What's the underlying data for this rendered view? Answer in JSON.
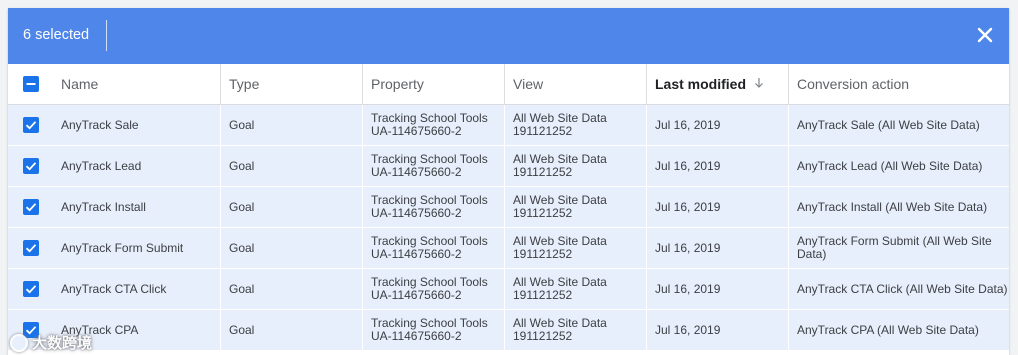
{
  "selection_bar": {
    "count_label": "6 selected",
    "close_icon": "close-icon",
    "color": "#4e86ea"
  },
  "table": {
    "columns": [
      {
        "label": "Name"
      },
      {
        "label": "Type"
      },
      {
        "label": "Property"
      },
      {
        "label": "View"
      },
      {
        "label": "Last modified",
        "sorted": true,
        "sort_icon": "arrow-down-icon"
      },
      {
        "label": "Conversion action"
      }
    ],
    "rows": [
      {
        "name": "AnyTrack Sale",
        "type": "Goal",
        "property_name": "Tracking School Tools",
        "property_id": "UA-114675660-2",
        "view_name": "All Web Site Data",
        "view_id": "191121252",
        "last_modified": "Jul 16, 2019",
        "conversion_action": "AnyTrack Sale (All Web Site Data)",
        "checked": true
      },
      {
        "name": "AnyTrack Lead",
        "type": "Goal",
        "property_name": "Tracking School Tools",
        "property_id": "UA-114675660-2",
        "view_name": "All Web Site Data",
        "view_id": "191121252",
        "last_modified": "Jul 16, 2019",
        "conversion_action": "AnyTrack Lead (All Web Site Data)",
        "checked": true
      },
      {
        "name": "AnyTrack Install",
        "type": "Goal",
        "property_name": "Tracking School Tools",
        "property_id": "UA-114675660-2",
        "view_name": "All Web Site Data",
        "view_id": "191121252",
        "last_modified": "Jul 16, 2019",
        "conversion_action": "AnyTrack Install (All Web Site Data)",
        "checked": true
      },
      {
        "name": "AnyTrack Form Submit",
        "type": "Goal",
        "property_name": "Tracking School Tools",
        "property_id": "UA-114675660-2",
        "view_name": "All Web Site Data",
        "view_id": "191121252",
        "last_modified": "Jul 16, 2019",
        "conversion_action": "AnyTrack Form Submit (All Web Site Data)",
        "checked": true
      },
      {
        "name": "AnyTrack CTA Click",
        "type": "Goal",
        "property_name": "Tracking School Tools",
        "property_id": "UA-114675660-2",
        "view_name": "All Web Site Data",
        "view_id": "191121252",
        "last_modified": "Jul 16, 2019",
        "conversion_action": "AnyTrack CTA Click (All Web Site Data)",
        "checked": true
      },
      {
        "name": "AnyTrack CPA",
        "type": "Goal",
        "property_name": "Tracking School Tools",
        "property_id": "UA-114675660-2",
        "view_name": "All Web Site Data",
        "view_id": "191121252",
        "last_modified": "Jul 16, 2019",
        "conversion_action": "AnyTrack CPA (All Web Site Data)",
        "checked": true
      }
    ]
  },
  "watermark": {
    "text": "大数跨境"
  },
  "colors": {
    "accent": "#1a73e8",
    "row_selected": "#e8effc"
  }
}
